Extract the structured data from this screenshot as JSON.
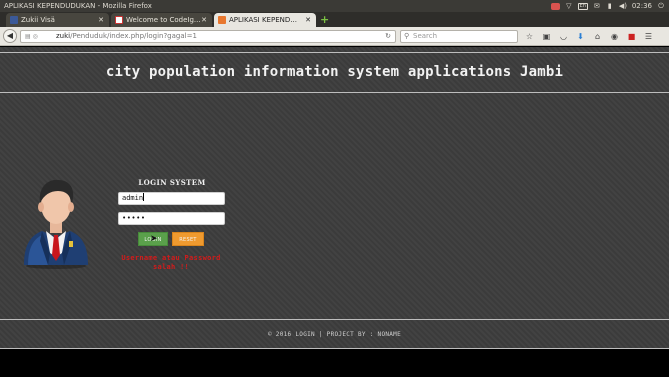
{
  "os_bar": {
    "window_title": "APLIKASI KEPENDUDUKAN - Mozilla Firefox",
    "keyboard_layout": "En",
    "clock": "02:36"
  },
  "tabs": [
    {
      "label": "Zukii Visä",
      "favicon": "facebook-icon",
      "active": false
    },
    {
      "label": "Welcome to CodeIg...",
      "favicon": "codeigniter-icon",
      "active": false
    },
    {
      "label": "APLIKASI KEPEND...",
      "favicon": "page-icon",
      "active": true
    }
  ],
  "new_tab_symbol": "+",
  "nav": {
    "url_host": "zuki",
    "url_path": "/Penduduk/index.php/login?gagal=1",
    "search_placeholder": "Search"
  },
  "page": {
    "site_title": "city population information system applications Jambi",
    "login_heading": "LOGIN SYSTEM",
    "username_value": "admin",
    "password_mask": "•••••",
    "login_button": "LOGIN",
    "reset_button": "RESET",
    "error_message": "Username atau Password salah !!",
    "footer_text": "© 2016 LOGIN | PROJECT BY : NONAME"
  },
  "colors": {
    "page_bg": "#3d3d3d",
    "login_button": "#5aa04b",
    "reset_button": "#ef9a2f",
    "error_text": "#d31b1b"
  }
}
